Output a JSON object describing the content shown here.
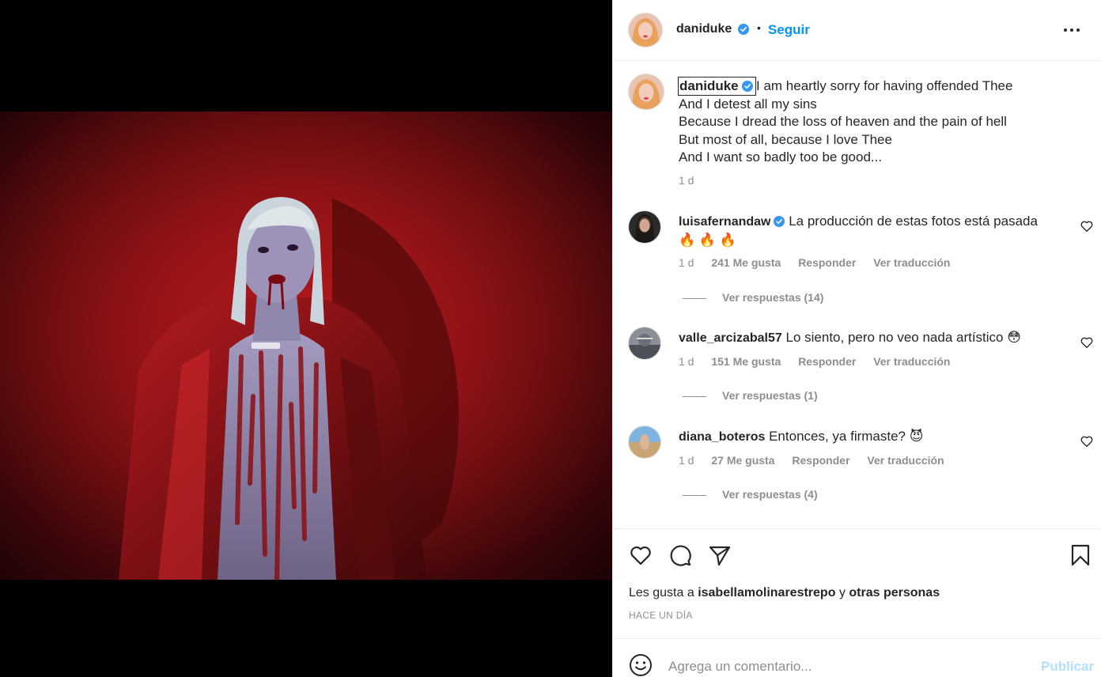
{
  "post": {
    "author": "daniduke",
    "follow_label": "Seguir",
    "separator": "•",
    "caption_lines": [
      "I am heartly sorry for having offended Thee",
      "And I detest all my sins",
      "Because I dread the loss of heaven and the pain of hell",
      "But most of all, because I love Thee",
      "And I want so badly too be good..."
    ],
    "caption_time": "1 d"
  },
  "comments": [
    {
      "user": "luisafernandaw",
      "verified": true,
      "text": "La producción de estas fotos está pasada",
      "emoji": "🔥 🔥 🔥",
      "time": "1 d",
      "likes": "241 Me gusta",
      "reply": "Responder",
      "translate": "Ver traducción",
      "replies": "Ver respuestas (14)"
    },
    {
      "user": "valle_arcizabal57",
      "verified": false,
      "text": "Lo siento, pero no veo nada artístico 😳",
      "emoji": "",
      "time": "1 d",
      "likes": "151 Me gusta",
      "reply": "Responder",
      "translate": "Ver traducción",
      "replies": "Ver respuestas (1)"
    },
    {
      "user": "diana_boteros",
      "verified": false,
      "text": "Entonces, ya firmaste? 😈",
      "emoji": "",
      "time": "1 d",
      "likes": "27 Me gusta",
      "reply": "Responder",
      "translate": "Ver traducción",
      "replies": "Ver respuestas (4)"
    }
  ],
  "footer": {
    "likes_prefix": "Les gusta a",
    "likes_user": "isabellamolinarestrepo",
    "likes_joiner": "y",
    "likes_others": "otras personas",
    "post_time": "HACE UN DÍA",
    "comment_placeholder": "Agrega un comentario...",
    "publish_label": "Publicar"
  },
  "colors": {
    "accent": "#0095f6",
    "publish_disabled": "#b2dffc",
    "verified": "#3897f0",
    "muted": "#8e8e8e"
  },
  "icons": [
    "verified-icon",
    "more-options-icon",
    "heart-icon",
    "comment-icon",
    "share-icon",
    "bookmark-icon",
    "emoji-icon"
  ]
}
